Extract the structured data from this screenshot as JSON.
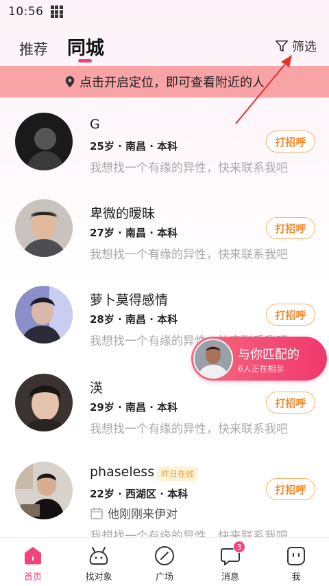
{
  "status": {
    "time": "10:56"
  },
  "tabs": {
    "recommend": "推荐",
    "same_city": "同城"
  },
  "filter": {
    "label": "筛选"
  },
  "location_bar": {
    "text": "点击开启定位，即可查看附近的人"
  },
  "greet_label": "打招呼",
  "users": [
    {
      "name": "G",
      "meta": "25岁 · 南昌 · 本科",
      "desc": "我想找一个有缘的异性，快来联系我吧"
    },
    {
      "name": "卑微的暧昧",
      "meta": "27岁 · 南昌 · 本科",
      "desc": "我想找一个有缘的异性，快来联系我吧"
    },
    {
      "name": "萝卜莫得感情",
      "meta": "28岁 · 南昌 · 本科",
      "desc": "我想找一个有缘的异性，快来联系我吧"
    },
    {
      "name": "渶",
      "meta": "29岁 · 南昌 · 本科",
      "desc": "我想找一个有缘的异性，快来联系我吧"
    },
    {
      "name": "phaseless",
      "online": "昨日在线",
      "meta": "22岁 · 西湖区 · 本科",
      "party": "他刚刚来伊对",
      "desc": "我想找一个有缘的异性，快来联系我吧"
    }
  ],
  "match": {
    "title": "与你匹配的",
    "subtitle": "6人正在相亲"
  },
  "bottom_nav": [
    {
      "label": "首页",
      "icon": "home-icon",
      "active": true
    },
    {
      "label": "找对象",
      "icon": "find-partner-icon"
    },
    {
      "label": "广场",
      "icon": "square-compass-icon"
    },
    {
      "label": "消息",
      "icon": "message-icon",
      "badge": "3"
    },
    {
      "label": "我",
      "icon": "profile-icon"
    }
  ],
  "colors": {
    "accent": "#f0457a",
    "location_bar": "#f8a3a5",
    "greet": "#f5892a"
  }
}
